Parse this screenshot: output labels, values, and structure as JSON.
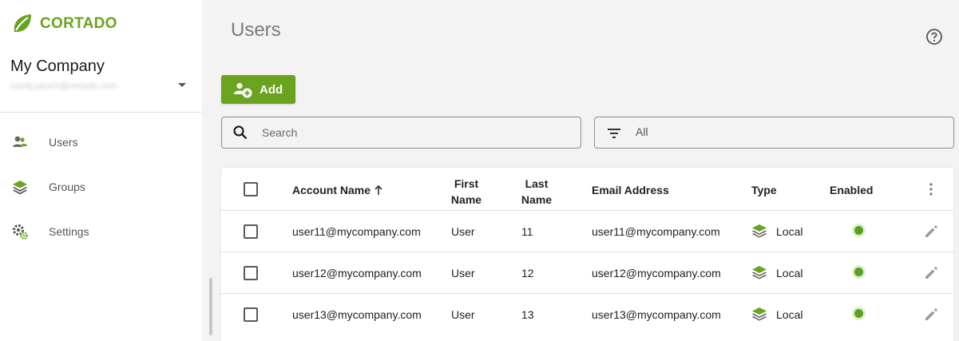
{
  "brand": {
    "name": "CORTADO",
    "color": "#6aa31f"
  },
  "sidebar": {
    "company_name": "My Company",
    "company_email": "candy.jaroch@cortado.com",
    "items": [
      {
        "label": "Users",
        "icon": "users-icon"
      },
      {
        "label": "Groups",
        "icon": "layers-icon"
      },
      {
        "label": "Settings",
        "icon": "gear-icon"
      }
    ]
  },
  "page": {
    "title": "Users"
  },
  "toolbar": {
    "add_label": "Add"
  },
  "search": {
    "placeholder": "Search",
    "value": ""
  },
  "filter": {
    "value": "All"
  },
  "table": {
    "columns": {
      "account": "Account Name",
      "first_l1": "First",
      "first_l2": "Name",
      "last_l1": "Last",
      "last_l2": "Name",
      "email": "Email Address",
      "type": "Type",
      "enabled": "Enabled"
    },
    "rows": [
      {
        "account": "user11@mycompany.com",
        "first": "User",
        "last": "11",
        "email": "user11@mycompany.com",
        "type": "Local",
        "enabled": true
      },
      {
        "account": "user12@mycompany.com",
        "first": "User",
        "last": "12",
        "email": "user12@mycompany.com",
        "type": "Local",
        "enabled": true
      },
      {
        "account": "user13@mycompany.com",
        "first": "User",
        "last": "13",
        "email": "user13@mycompany.com",
        "type": "Local",
        "enabled": true
      }
    ]
  },
  "colors": {
    "accent": "#6aa31f",
    "status_on": "#58a21e"
  }
}
